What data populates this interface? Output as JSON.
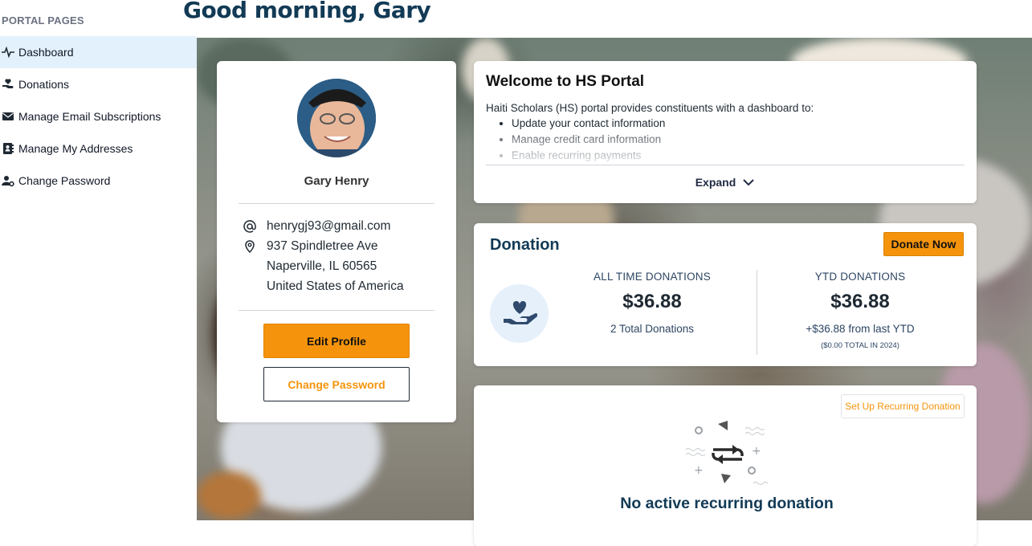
{
  "sidebar": {
    "heading": "PORTAL PAGES",
    "items": [
      {
        "label": "Dashboard",
        "icon": "activity-icon",
        "active": true
      },
      {
        "label": "Donations",
        "icon": "hand-donation-icon",
        "active": false
      },
      {
        "label": "Manage Email Subscriptions",
        "icon": "envelope-icon",
        "active": false
      },
      {
        "label": "Manage My Addresses",
        "icon": "address-book-icon",
        "active": false
      },
      {
        "label": "Change Password",
        "icon": "user-gear-icon",
        "active": false
      }
    ]
  },
  "header": {
    "greeting": "Good morning, Gary"
  },
  "profile": {
    "name": "Gary Henry",
    "email": "henrygj93@gmail.com",
    "address": {
      "line1": "937 Spindletree Ave",
      "line2": "Naperville, IL 60565",
      "line3": "United States of America"
    },
    "edit_label": "Edit Profile",
    "change_password_label": "Change Password"
  },
  "welcome": {
    "title": "Welcome to HS Portal",
    "intro": "Haiti Scholars (HS) portal provides constituents with a dashboard to:",
    "items": [
      "Update your contact information",
      "Manage credit card information",
      "Enable recurring payments"
    ],
    "expand_label": "Expand"
  },
  "donation": {
    "title": "Donation",
    "donate_label": "Donate Now",
    "all_time": {
      "label": "ALL TIME DONATIONS",
      "value": "$36.88",
      "sub": "2 Total Donations"
    },
    "ytd": {
      "label": "YTD DONATIONS",
      "value": "$36.88",
      "sub": "+$36.88 from last YTD",
      "note": "($0.00 TOTAL IN 2024)"
    }
  },
  "recurring": {
    "button_label": "Set Up Recurring Donation",
    "message": "No active recurring donation"
  },
  "colors": {
    "accent": "#f5940c",
    "heading": "#123a55",
    "active_nav": "#e3f1fd"
  }
}
